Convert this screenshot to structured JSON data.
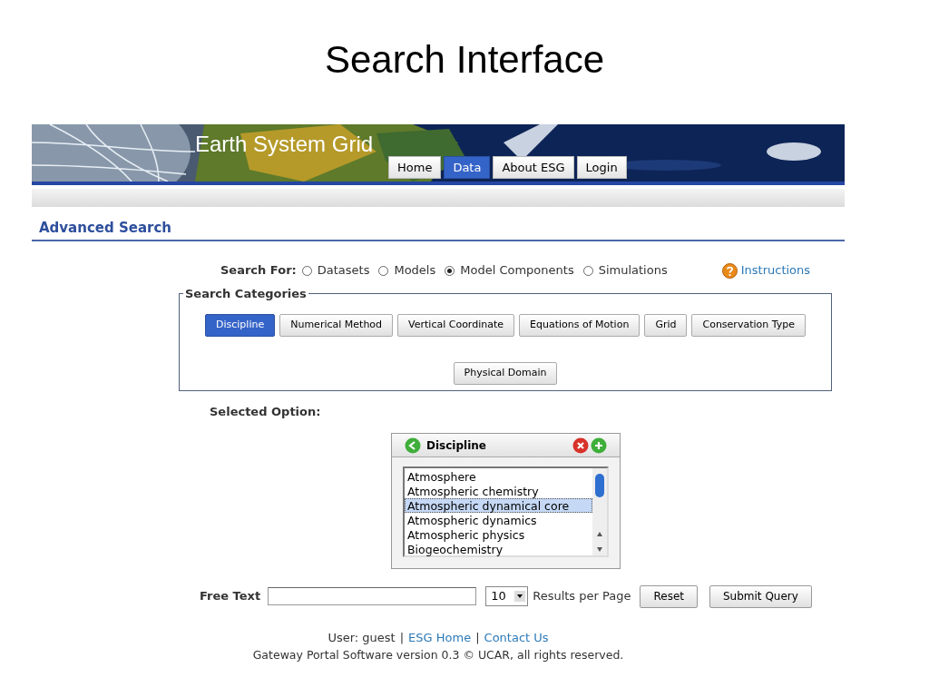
{
  "slide_title": "Search Interface",
  "banner": {
    "site_title": "Earth System Grid",
    "nav": [
      {
        "label": "Home",
        "selected": false
      },
      {
        "label": "Data",
        "selected": true
      },
      {
        "label": "About ESG",
        "selected": false
      },
      {
        "label": "Login",
        "selected": false
      }
    ]
  },
  "heading": "Advanced Search",
  "search_for": {
    "label": "Search For:",
    "options": [
      {
        "label": "Datasets",
        "selected": false
      },
      {
        "label": "Models",
        "selected": false
      },
      {
        "label": "Model Components",
        "selected": true
      },
      {
        "label": "Simulations",
        "selected": false
      }
    ]
  },
  "instructions": "Instructions",
  "categories": {
    "legend": "Search Categories",
    "buttons": [
      {
        "label": "Discipline",
        "selected": true
      },
      {
        "label": "Numerical Method",
        "selected": false
      },
      {
        "label": "Vertical Coordinate",
        "selected": false
      },
      {
        "label": "Equations of Motion",
        "selected": false
      },
      {
        "label": "Grid",
        "selected": false
      },
      {
        "label": "Conservation Type",
        "selected": false
      },
      {
        "label": "Physical Domain",
        "selected": false
      }
    ]
  },
  "selected_option_label": "Selected Option:",
  "option_panel": {
    "title": "Discipline",
    "items": [
      {
        "label": "Atmosphere",
        "selected": false
      },
      {
        "label": "Atmospheric chemistry",
        "selected": false
      },
      {
        "label": "Atmospheric dynamical core",
        "selected": true
      },
      {
        "label": "Atmospheric dynamics",
        "selected": false
      },
      {
        "label": "Atmospheric physics",
        "selected": false
      },
      {
        "label": "Biogeochemistry",
        "selected": false
      }
    ]
  },
  "free_text": {
    "label": "Free Text"
  },
  "results_per_page": {
    "value": "10",
    "label": "Results per Page"
  },
  "buttons": [
    "Reset",
    "Submit Query"
  ],
  "footer": {
    "parts": [
      {
        "kind": "text",
        "text": "User: guest"
      },
      {
        "kind": "separator",
        "text": "|"
      },
      {
        "kind": "link",
        "text": "ESG Home"
      },
      {
        "kind": "separator",
        "text": "|"
      },
      {
        "kind": "link",
        "text": "Contact Us"
      }
    ],
    "copyright": "Gateway Portal Software version 0.3 © UCAR, all rights reserved."
  }
}
